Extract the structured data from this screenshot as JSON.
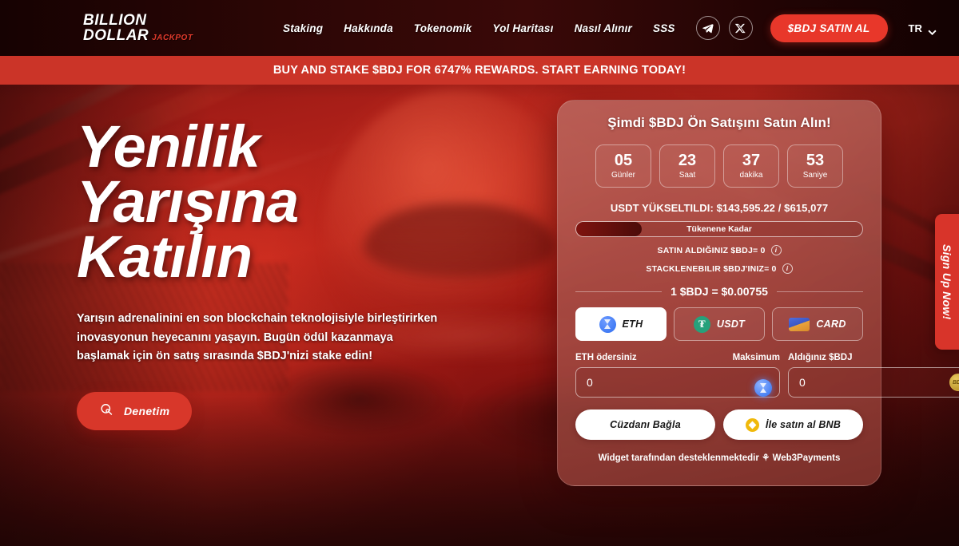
{
  "header": {
    "logo": {
      "line1": "BILLION",
      "line2": "DOLLAR",
      "badge": "JACKPOT"
    },
    "nav": [
      {
        "label": "Staking"
      },
      {
        "label": "Hakkında"
      },
      {
        "label": "Tokenomik"
      },
      {
        "label": "Yol Haritası"
      },
      {
        "label": "Nasıl Alınır"
      },
      {
        "label": "SSS"
      }
    ],
    "social": [
      {
        "name": "telegram-icon"
      },
      {
        "name": "x-twitter-icon"
      }
    ],
    "cta_label": "$BDJ SATIN AL",
    "language": "TR",
    "accent_color": "#e8372a"
  },
  "banner": {
    "text": "BUY AND STAKE $BDJ FOR 6747% REWARDS. START EARNING TODAY!",
    "background_color": "#cb3428"
  },
  "hero": {
    "heading_line1": "Yenilik",
    "heading_line2": "Yarışına",
    "heading_line3": "Katılın",
    "paragraph": "Yarışın adrenalinini en son blockchain teknolojisiyle birleştirirken inovasyonun heyecanını yaşayın. Bugün ödül kazanmaya başlamak için ön satış sırasında $BDJ'nizi stake edin!",
    "audit_button": "Denetim"
  },
  "widget": {
    "title": "Şimdi $BDJ Ön Satışını Satın Alın!",
    "countdown": [
      {
        "value": "05",
        "label": "Günler"
      },
      {
        "value": "23",
        "label": "Saat"
      },
      {
        "value": "37",
        "label": "dakika"
      },
      {
        "value": "53",
        "label": "Saniye"
      }
    ],
    "raised_text": "USDT YÜKSELTILDI: $143,595.22 / $615,077",
    "raised_current": "$143,595.22",
    "raised_goal": "$615,077",
    "progress_label": "Tükenene Kadar",
    "progress_percent": 23,
    "balances": [
      {
        "label": "SATIN ALDIĞINIZ $BDJ= 0",
        "info": "i"
      },
      {
        "label": "STACKLENEBILIR $BDJ'INIZ= 0",
        "info": "i"
      }
    ],
    "price_text": "1 $BDJ = $0.00755",
    "payment_tabs": [
      {
        "label": "ETH",
        "icon": "eth-coin-icon",
        "active": true
      },
      {
        "label": "USDT",
        "icon": "usdt-coin-icon",
        "active": false
      },
      {
        "label": "CARD",
        "icon": "credit-card-icon",
        "active": false
      }
    ],
    "pay_field": {
      "label": "ETH ödersiniz",
      "max_label": "Maksimum",
      "value": "0",
      "placeholder": "0",
      "icon": "eth-coin-icon"
    },
    "receive_field": {
      "label": "Aldığınız $BDJ",
      "value": "0",
      "placeholder": "0",
      "icon": "bdj-coin-icon"
    },
    "actions": [
      {
        "label": "Cüzdanı Bağla",
        "icon": ""
      },
      {
        "label": "İle satın al BNB",
        "icon": "bnb-coin-icon"
      }
    ],
    "powered_prefix": "Widget tarafından desteklenmektedir",
    "powered_symbol": "⚘",
    "powered_brand": "Web3Payments"
  },
  "signup_tab": {
    "label": "Sign Up Now!"
  }
}
